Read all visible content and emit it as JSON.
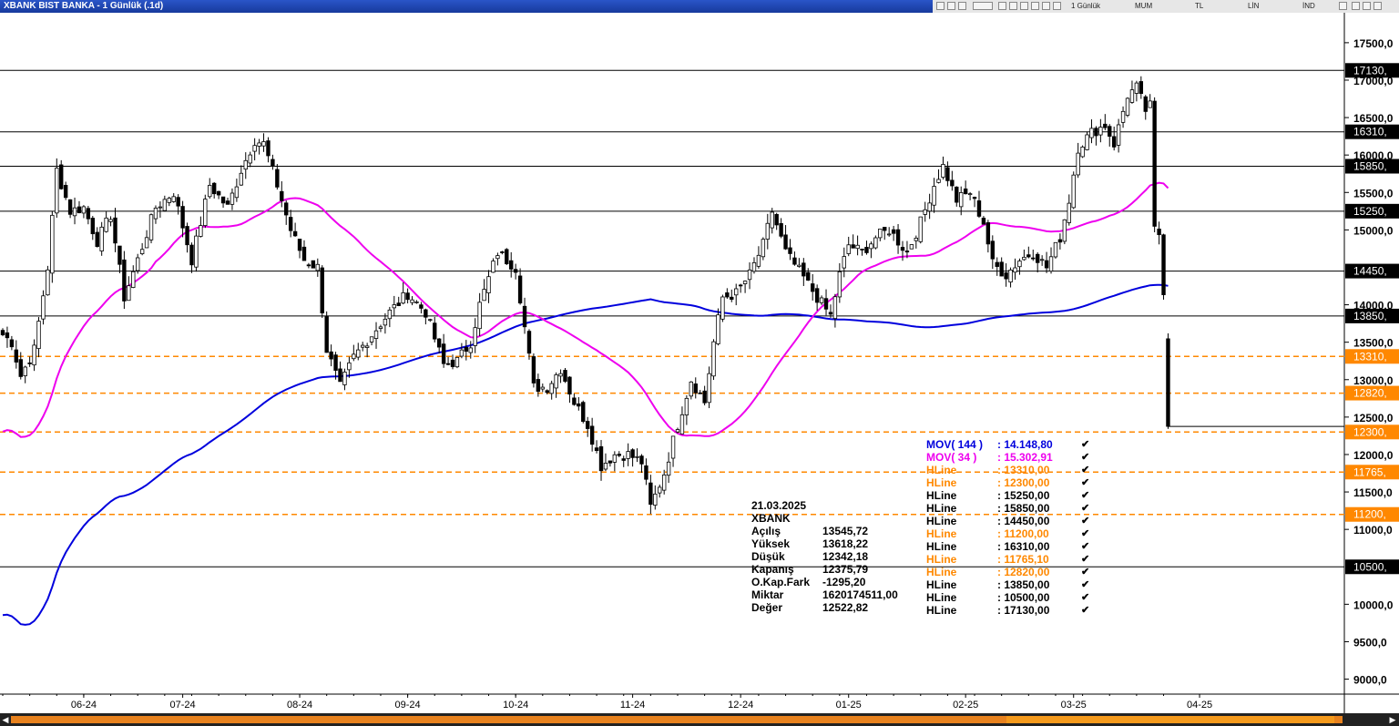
{
  "window": {
    "title": "XBANK BIST BANKA - 1 Günlük (.1d)"
  },
  "toolbar": {
    "items": [
      "1 Günlük",
      "MUM",
      "TL",
      "LİN",
      "İND"
    ]
  },
  "chart_data": {
    "type": "candlestick",
    "ylim": [
      8800,
      17900
    ],
    "y_ticks": [
      "17500,0",
      "17000,0",
      "16500,0",
      "16000,0",
      "15500,0",
      "15000,0",
      "14000,0",
      "13500,0",
      "13000,0",
      "12500,0",
      "12000,0",
      "11500,0",
      "11000,0",
      "10000,0",
      "9500,0",
      "9000,0"
    ],
    "y_tick_values": [
      17500,
      17000,
      16500,
      16000,
      15500,
      15000,
      14000,
      13500,
      13000,
      12500,
      12000,
      11500,
      11000,
      10000,
      9500,
      9000
    ],
    "x_labels": [
      "06-24",
      "07-24",
      "08-24",
      "09-24",
      "10-24",
      "11-24",
      "12-24",
      "01-25",
      "02-25",
      "03-25",
      "04-25"
    ],
    "x_label_index": [
      18,
      40,
      66,
      90,
      114,
      140,
      164,
      188,
      214,
      238,
      266
    ],
    "hlines": [
      {
        "value": 17130,
        "label": "17130,",
        "style": "solid"
      },
      {
        "value": 16310,
        "label": "16310,",
        "style": "solid"
      },
      {
        "value": 15850,
        "label": "15850,",
        "style": "solid"
      },
      {
        "value": 15250,
        "label": "15250,",
        "style": "solid"
      },
      {
        "value": 14450,
        "label": "14450,",
        "style": "solid"
      },
      {
        "value": 13850,
        "label": "13850,",
        "style": "solid"
      },
      {
        "value": 13310,
        "label": "13310,",
        "style": "dashed"
      },
      {
        "value": 12820,
        "label": "12820,",
        "style": "dashed"
      },
      {
        "value": 12300,
        "label": "12300,",
        "style": "dashed"
      },
      {
        "value": 11765,
        "label": "11765,",
        "style": "dashed"
      },
      {
        "value": 11200,
        "label": "11200,",
        "style": "dashed"
      },
      {
        "value": 10500,
        "label": "10500,",
        "style": "solid"
      }
    ],
    "close_anchors": [
      [
        0,
        13600
      ],
      [
        2,
        13500
      ],
      [
        4,
        13050
      ],
      [
        7,
        13400
      ],
      [
        10,
        14500
      ],
      [
        12,
        15800
      ],
      [
        15,
        15250
      ],
      [
        18,
        15300
      ],
      [
        21,
        14850
      ],
      [
        24,
        15200
      ],
      [
        27,
        14100
      ],
      [
        30,
        14600
      ],
      [
        34,
        15300
      ],
      [
        38,
        15500
      ],
      [
        42,
        14600
      ],
      [
        46,
        15600
      ],
      [
        50,
        15300
      ],
      [
        53,
        15800
      ],
      [
        56,
        16200
      ],
      [
        58,
        16150
      ],
      [
        61,
        15600
      ],
      [
        64,
        15000
      ],
      [
        67,
        14600
      ],
      [
        70,
        14500
      ],
      [
        72,
        13400
      ],
      [
        75,
        12900
      ],
      [
        78,
        13300
      ],
      [
        82,
        13600
      ],
      [
        86,
        13900
      ],
      [
        90,
        14150
      ],
      [
        94,
        13900
      ],
      [
        98,
        13200
      ],
      [
        101,
        13250
      ],
      [
        104,
        13500
      ],
      [
        106,
        14000
      ],
      [
        110,
        14700
      ],
      [
        114,
        14500
      ],
      [
        116,
        13700
      ],
      [
        118,
        12900
      ],
      [
        121,
        12900
      ],
      [
        124,
        13150
      ],
      [
        127,
        12700
      ],
      [
        130,
        12400
      ],
      [
        133,
        11850
      ],
      [
        136,
        12000
      ],
      [
        139,
        12000
      ],
      [
        142,
        11900
      ],
      [
        144,
        11300
      ],
      [
        147,
        11750
      ],
      [
        150,
        12400
      ],
      [
        153,
        13000
      ],
      [
        156,
        12700
      ],
      [
        158,
        13500
      ],
      [
        160,
        14100
      ],
      [
        163,
        14150
      ],
      [
        166,
        14400
      ],
      [
        169,
        14800
      ],
      [
        171,
        15250
      ],
      [
        174,
        14700
      ],
      [
        177,
        14450
      ],
      [
        181,
        14100
      ],
      [
        184,
        13850
      ],
      [
        186,
        14400
      ],
      [
        188,
        14800
      ],
      [
        191,
        14700
      ],
      [
        194,
        14900
      ],
      [
        197,
        15000
      ],
      [
        201,
        14700
      ],
      [
        204,
        15100
      ],
      [
        207,
        15600
      ],
      [
        209,
        15850
      ],
      [
        212,
        15400
      ],
      [
        215,
        15500
      ],
      [
        218,
        15100
      ],
      [
        220,
        14550
      ],
      [
        223,
        14400
      ],
      [
        226,
        14600
      ],
      [
        229,
        14700
      ],
      [
        232,
        14500
      ],
      [
        235,
        14900
      ],
      [
        237,
        15400
      ],
      [
        239,
        16100
      ],
      [
        242,
        16300
      ],
      [
        245,
        16400
      ],
      [
        247,
        16150
      ],
      [
        250,
        16800
      ],
      [
        252,
        16900
      ],
      [
        254,
        16600
      ],
      [
        255,
        16650
      ],
      [
        256,
        15000
      ],
      [
        257,
        14950
      ],
      [
        258,
        14200
      ],
      [
        259,
        12376
      ]
    ],
    "last_candle": {
      "date": "21.03.2025",
      "open": 13545.72,
      "high": 13618.22,
      "low": 12342.18,
      "close": 12375.79
    },
    "series": [
      {
        "name": "MOV( 144 )",
        "color": "#0000dd",
        "value": "14.148,80"
      },
      {
        "name": "MOV( 34 )",
        "color": "#ee00ee",
        "value": "15.302,91"
      }
    ]
  },
  "legend": [
    {
      "name": "MOV( 144 )",
      "value": ": 14.148,80",
      "color": "#0000dd"
    },
    {
      "name": "MOV( 34 )",
      "value": ": 15.302,91",
      "color": "#ee00ee"
    },
    {
      "name": "HLine",
      "value": ": 13310,00",
      "color": "#ff8800"
    },
    {
      "name": "HLine",
      "value": ": 12300,00",
      "color": "#ff8800"
    },
    {
      "name": "HLine",
      "value": ": 15250,00",
      "color": "#000000"
    },
    {
      "name": "HLine",
      "value": ": 15850,00",
      "color": "#000000"
    },
    {
      "name": "HLine",
      "value": ": 14450,00",
      "color": "#000000"
    },
    {
      "name": "HLine",
      "value": ": 11200,00",
      "color": "#ff8800"
    },
    {
      "name": "HLine",
      "value": ": 16310,00",
      "color": "#000000"
    },
    {
      "name": "HLine",
      "value": ": 11765,10",
      "color": "#ff8800"
    },
    {
      "name": "HLine",
      "value": ": 12820,00",
      "color": "#ff8800"
    },
    {
      "name": "HLine",
      "value": ": 13850,00",
      "color": "#000000"
    },
    {
      "name": "HLine",
      "value": ": 10500,00",
      "color": "#000000"
    },
    {
      "name": "HLine",
      "value": ": 17130,00",
      "color": "#000000"
    }
  ],
  "info": {
    "date": "21.03.2025",
    "symbol": "XBANK",
    "rows": [
      {
        "k": "Açılış",
        "v": "13545,72"
      },
      {
        "k": "Yüksek",
        "v": "13618,22"
      },
      {
        "k": "Düşük",
        "v": "12342,18"
      },
      {
        "k": "Kapanış",
        "v": "12375,79"
      },
      {
        "k": "O.Kap.Fark",
        "v": "-1295,20"
      },
      {
        "k": "Miktar",
        "v": "1620174511,00"
      },
      {
        "k": "Değer",
        "v": "12522,82"
      }
    ]
  },
  "colors": {
    "orange": "#ff8800",
    "axis_label_bg": "#000000",
    "ma144": "#0000dd",
    "ma34": "#ee00ee"
  }
}
